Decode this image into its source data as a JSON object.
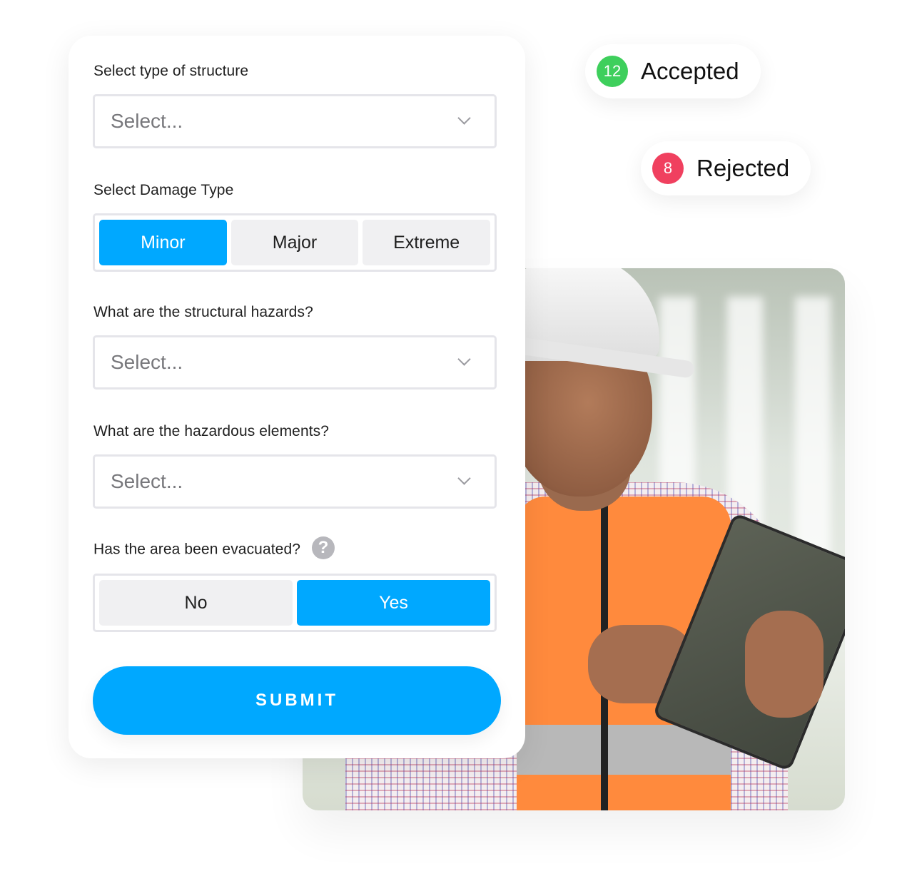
{
  "form": {
    "fields": [
      {
        "label": "Select type of structure",
        "placeholder": "Select..."
      },
      {
        "label": "Select Damage Type",
        "options": [
          "Minor",
          "Major",
          "Extreme"
        ],
        "selected": "Minor"
      },
      {
        "label": "What are the structural hazards?",
        "placeholder": "Select..."
      },
      {
        "label": "What are the hazardous elements?",
        "placeholder": "Select..."
      },
      {
        "label": "Has the area been evacuated?",
        "help_icon": "?",
        "options": [
          "No",
          "Yes"
        ],
        "selected": "Yes"
      }
    ],
    "submit_label": "SUBMIT"
  },
  "status": {
    "accepted": {
      "count": "12",
      "label": "Accepted",
      "color": "#3ecf5c"
    },
    "rejected": {
      "count": "8",
      "label": "Rejected",
      "color": "#f0405f"
    }
  },
  "colors": {
    "accent": "#00a8ff"
  },
  "photo": {
    "description": "construction worker in hard hat and orange safety vest using a tablet"
  }
}
